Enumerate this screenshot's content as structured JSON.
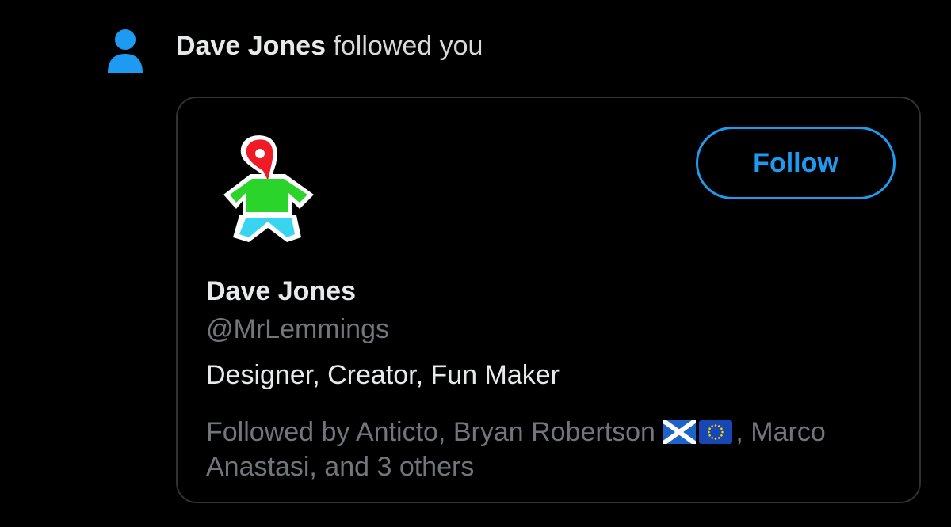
{
  "notification": {
    "icon": "person-icon",
    "actor_name": "Dave Jones",
    "action_text": " followed you"
  },
  "profile_card": {
    "avatar_icon": "lemming-logo",
    "follow_label": "Follow",
    "display_name": "Dave Jones",
    "handle": "@MrLemmings",
    "bio": "Designer, Creator, Fun Maker",
    "followed_by": {
      "prefix": "Followed by Anticto, Bryan Robertson ",
      "flags": [
        "scotland-flag-icon",
        "eu-flag-icon"
      ],
      "suffix": ", Marco Anastasi, and 3 others"
    }
  },
  "colors": {
    "background": "#000000",
    "accent": "#1d9bf0",
    "primary_text": "#e7e9ea",
    "secondary_text": "#71767b",
    "border": "#2f3336"
  }
}
